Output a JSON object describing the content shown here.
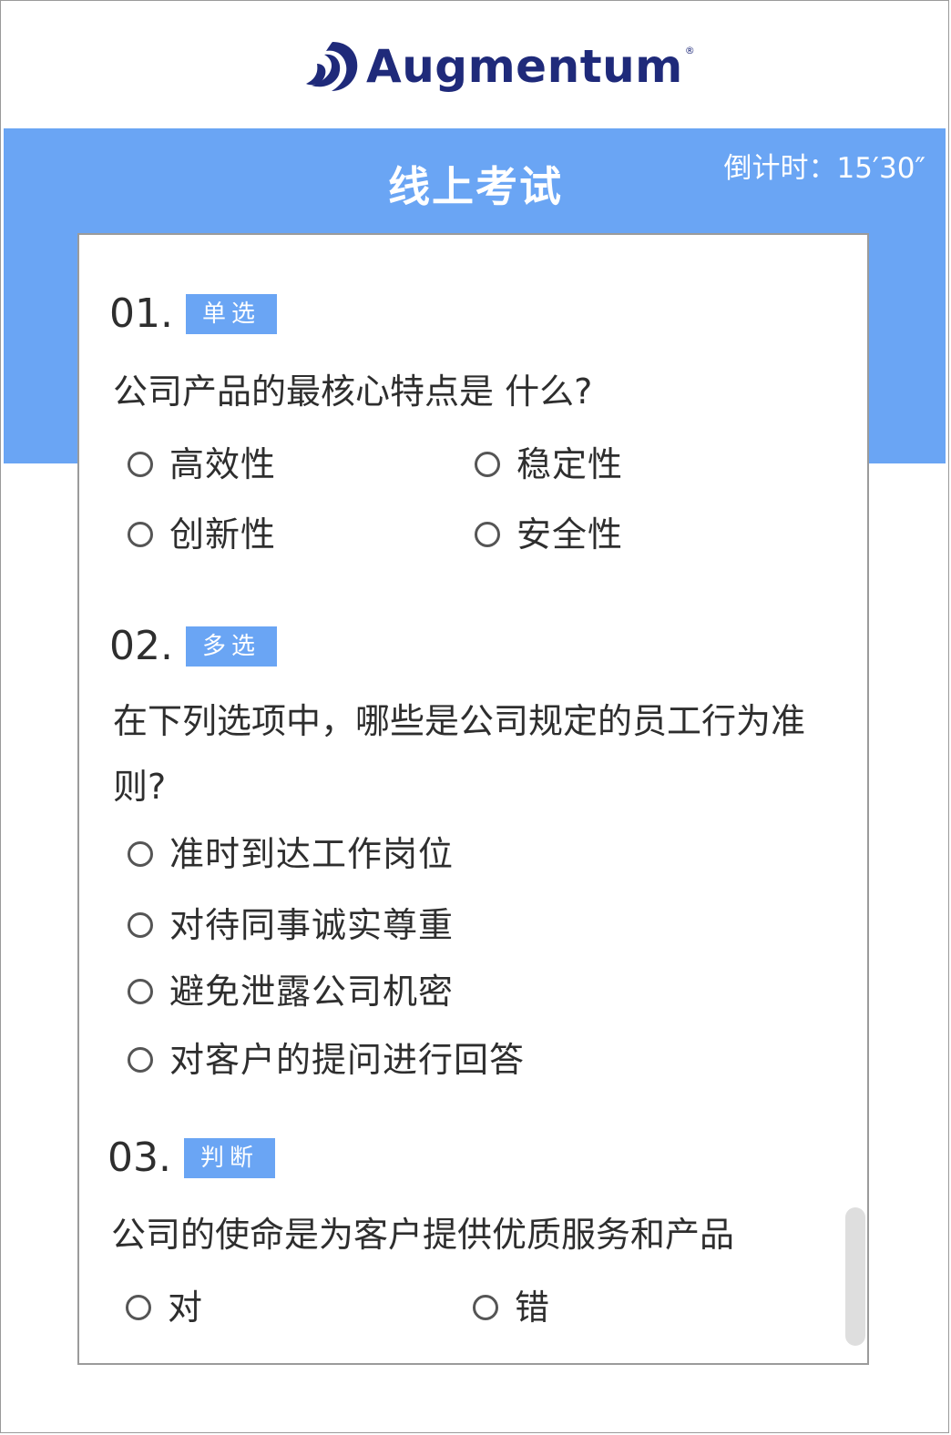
{
  "brand": {
    "name": "Augmentum",
    "reg": "®"
  },
  "header": {
    "title": "线上考试",
    "timer": "倒计时：15′30″"
  },
  "colors": {
    "accent": "#6aa5f4",
    "logo": "#1f2a7a"
  },
  "questions": [
    {
      "number": "01.",
      "type": "单选",
      "text": "公司产品的最核心特点是 什么?",
      "options": [
        "高效性",
        "稳定性",
        "创新性",
        "安全性"
      ]
    },
    {
      "number": "02.",
      "type": "多选",
      "text": "在下列选项中，哪些是公司规定的员工行为准则?",
      "options": [
        "准时到达工作岗位",
        "对待同事诚实尊重",
        "避免泄露公司机密",
        "对客户的提问进行回答"
      ]
    },
    {
      "number": "03.",
      "type": "判断",
      "text": "公司的使命是为客户提供优质服务和产品",
      "options": [
        "对",
        "错"
      ]
    }
  ]
}
